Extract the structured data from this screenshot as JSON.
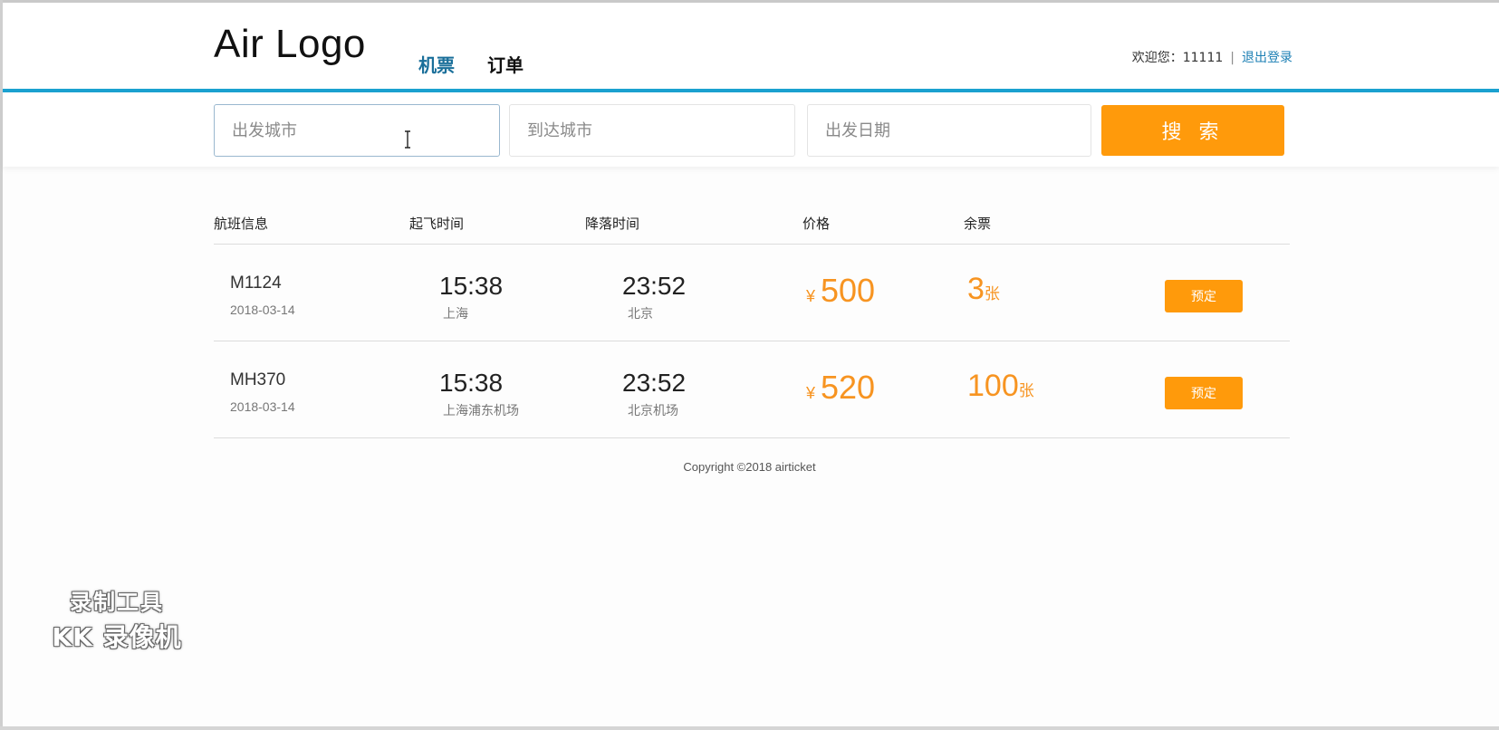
{
  "header": {
    "logo": "Air Logo",
    "nav": {
      "tickets": "机票",
      "orders": "订单"
    },
    "user": {
      "welcome": "欢迎您：11111",
      "separator": "|",
      "logout": "退出登录"
    }
  },
  "search": {
    "departure_placeholder": "出发城市",
    "arrival_placeholder": "到达城市",
    "date_placeholder": "出发日期",
    "button_label": "搜 索"
  },
  "table": {
    "headers": {
      "flight": "航班信息",
      "departure": "起飞时间",
      "arrival": "降落时间",
      "price": "价格",
      "seats": "余票"
    },
    "rows": [
      {
        "flight_no": "M1124",
        "date": "2018-03-14",
        "dep_time": "15:38",
        "dep_place": "上海",
        "arr_time": "23:52",
        "arr_place": "北京",
        "currency": "¥",
        "price": "500",
        "seats": "3",
        "seat_unit": "张",
        "book_label": "预定"
      },
      {
        "flight_no": "MH370",
        "date": "2018-03-14",
        "dep_time": "15:38",
        "dep_place": "上海浦东机场",
        "arr_time": "23:52",
        "arr_place": "北京机场",
        "currency": "¥",
        "price": "520",
        "seats": "100",
        "seat_unit": "张",
        "book_label": "预定"
      }
    ]
  },
  "footer": {
    "copyright": "Copyright ©2018 airticket"
  },
  "watermark": {
    "line1": "录制工具",
    "line2": "KK 录像机"
  },
  "colors": {
    "accent": "#1ba1d0",
    "action": "#ff9a0b",
    "price": "#f79421",
    "link": "#1b7fb4"
  },
  "icons": {
    "cursor": "text-cursor-icon"
  }
}
